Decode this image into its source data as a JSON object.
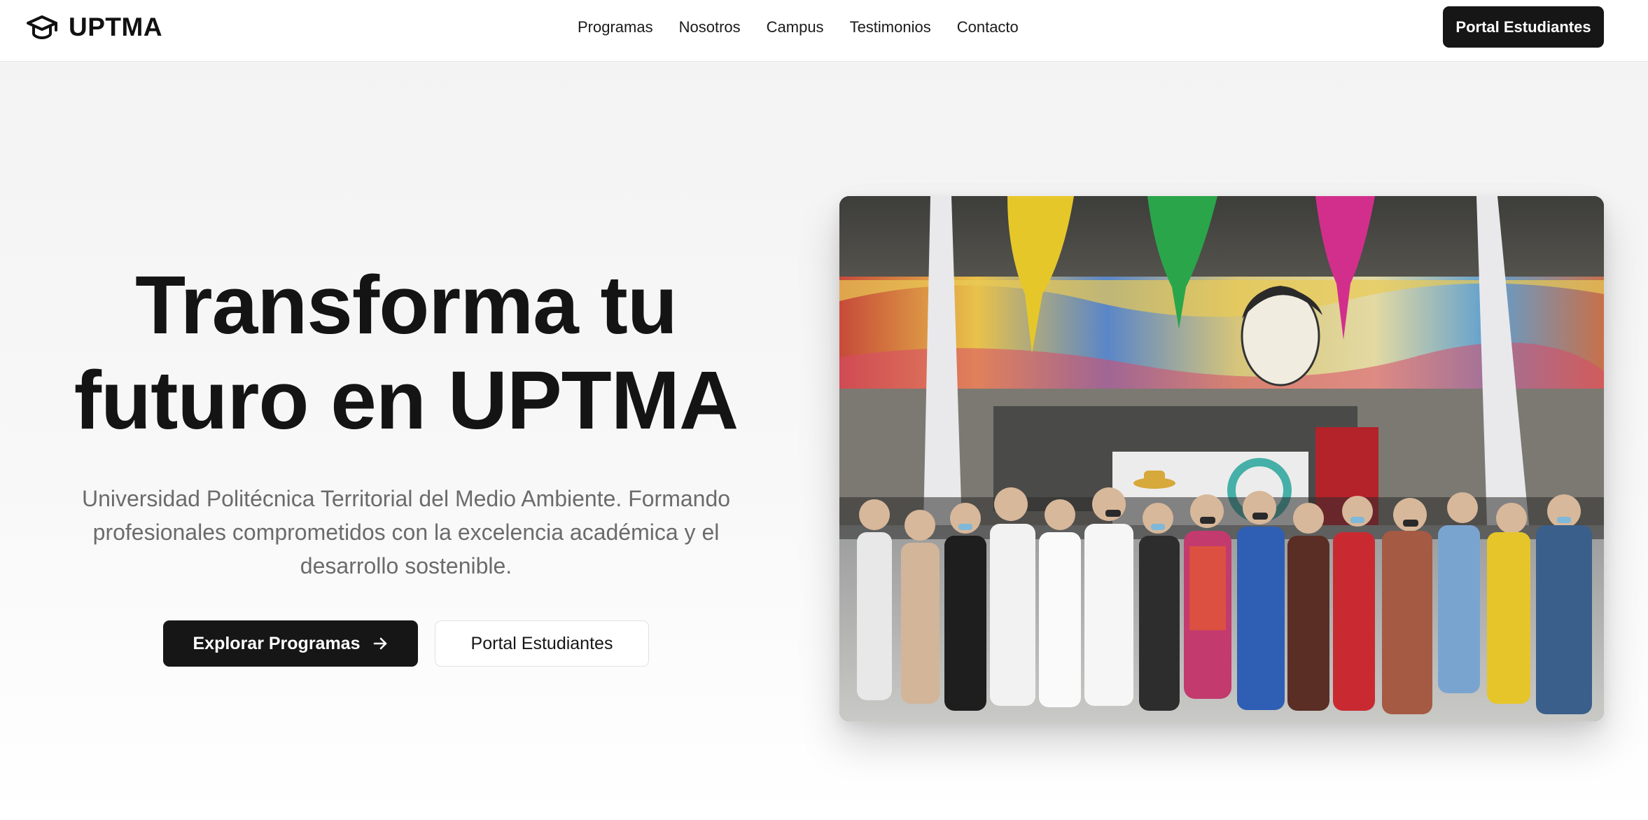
{
  "brand": {
    "name": "UPTMA",
    "icon": "graduation-cap-icon"
  },
  "nav": {
    "links": [
      {
        "label": "Programas"
      },
      {
        "label": "Nosotros"
      },
      {
        "label": "Campus"
      },
      {
        "label": "Testimonios"
      },
      {
        "label": "Contacto"
      }
    ],
    "portal_button": "Portal Estudiantes"
  },
  "hero": {
    "title_line1": "Transforma tu",
    "title_line2": "futuro en UPTMA",
    "subtitle": "Universidad Politécnica Territorial del Medio Ambiente. Formando profesionales comprometidos con la excelencia académica y el desarrollo sostenible.",
    "primary_button": "Explorar Programas",
    "primary_button_icon": "arrow-right-icon",
    "secondary_button": "Portal Estudiantes"
  },
  "colors": {
    "dark": "#161616",
    "muted_text": "#6b6b6b",
    "background": "#f3f3f3"
  }
}
